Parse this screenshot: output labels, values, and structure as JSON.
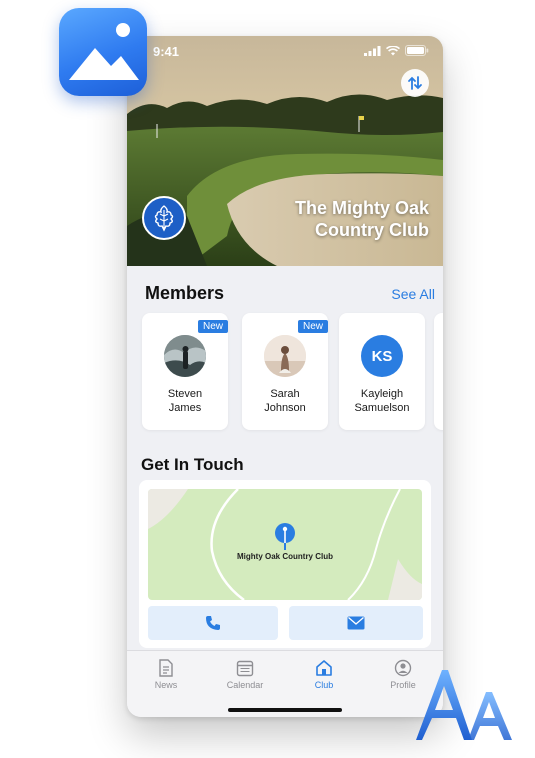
{
  "status_bar": {
    "time": "9:41"
  },
  "hero": {
    "club_name_line1": "The Mighty Oak",
    "club_name_line2": "Country Club"
  },
  "members": {
    "title": "Members",
    "see_all": "See All",
    "items": [
      {
        "name_line1": "Steven",
        "name_line2": "James",
        "badge": "New",
        "avatar": "photo"
      },
      {
        "name_line1": "Sarah",
        "name_line2": "Johnson",
        "badge": "New",
        "avatar": "photo"
      },
      {
        "name_line1": "Kayleigh",
        "name_line2": "Samuelson",
        "initials": "KS",
        "avatar": "initials"
      }
    ]
  },
  "contact": {
    "title": "Get In Touch",
    "map_label": "Mighty Oak Country Club",
    "phone_icon": "phone-icon",
    "email_icon": "envelope-icon"
  },
  "tabs": [
    {
      "label": "News",
      "icon": "news-icon",
      "active": false
    },
    {
      "label": "Calendar",
      "icon": "calendar-icon",
      "active": false
    },
    {
      "label": "Club",
      "icon": "home-icon",
      "active": true
    },
    {
      "label": "Profile",
      "icon": "person-icon",
      "active": false
    }
  ],
  "colors": {
    "accent": "#2a7de1",
    "club_logo": "#1d5fc6",
    "map_green": "#d4ebbe"
  }
}
